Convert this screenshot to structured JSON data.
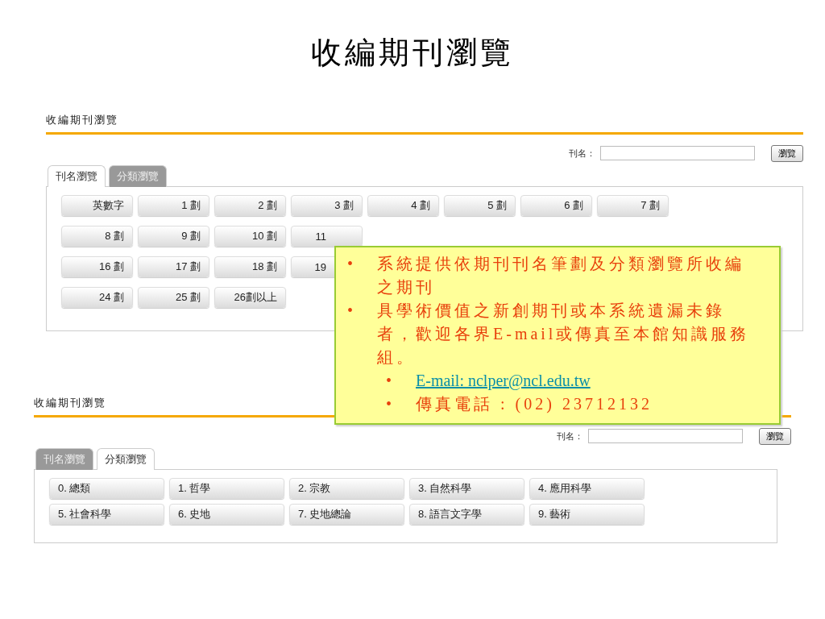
{
  "slide_title": "收編期刊瀏覽",
  "panels": [
    {
      "kind": "stroke",
      "heading": "收編期刊瀏覽",
      "search": {
        "label": "刊名：",
        "button": "瀏覽"
      },
      "tabs": [
        {
          "label": "刊名瀏覽",
          "selected": true
        },
        {
          "label": "分類瀏覽",
          "selected": false
        }
      ],
      "rows": [
        [
          "英數字",
          "1 劃",
          "2 劃",
          "3 劃",
          "4 劃",
          "5 劃",
          "6 劃",
          "7 劃"
        ],
        [
          "8 劃",
          "9 劃",
          "10 劃",
          "11"
        ],
        [
          "16 劃",
          "17 劃",
          "18 劃",
          "19"
        ],
        [
          "24 劃",
          "25 劃",
          "26劃以上"
        ]
      ]
    },
    {
      "kind": "category",
      "heading": "收編期刊瀏覽",
      "search": {
        "label": "刊名：",
        "button": "瀏覽"
      },
      "tabs": [
        {
          "label": "刊名瀏覽",
          "selected": false
        },
        {
          "label": "分類瀏覽",
          "selected": true
        }
      ],
      "rows": [
        [
          "0. 總類",
          "1. 哲學",
          "2. 宗教",
          "3. 自然科學",
          "4. 應用科學"
        ],
        [
          "5. 社會科學",
          "6. 史地",
          "7. 史地總論",
          "8. 語言文字學",
          "9. 藝術"
        ]
      ]
    }
  ],
  "callout": {
    "items": [
      {
        "bullet": "•",
        "text": "系統提供依期刊刊名筆劃及分類瀏覽所收編之期刊"
      },
      {
        "bullet": "•",
        "text": "具學術價值之新創期刊或本系統遺漏未錄者，歡迎各界E-mail或傳真至本館知識服務組。",
        "children": [
          {
            "kind": "link",
            "bullet": "•",
            "text": "E-mail: nclper@ncl.edu.tw"
          },
          {
            "kind": "text",
            "bullet": "•",
            "text": "傳真電話 : (02) 23712132"
          }
        ]
      }
    ]
  }
}
